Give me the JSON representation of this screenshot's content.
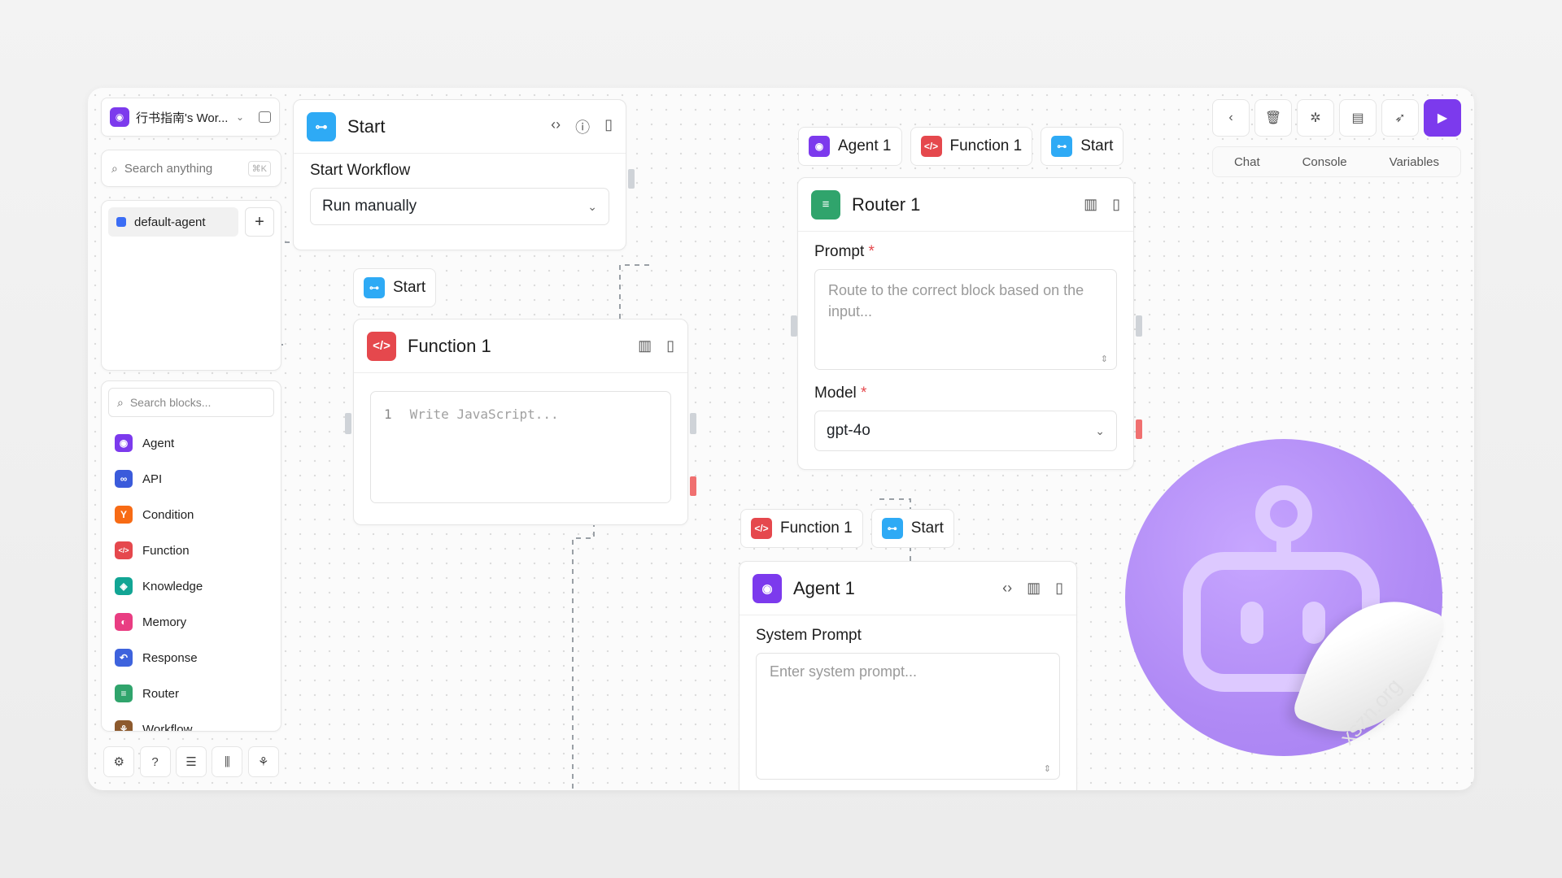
{
  "sidebar": {
    "workspace_title": "行书指南's Wor...",
    "search_placeholder": "Search anything",
    "search_shortcut": "⌘K",
    "agent_name": "default-agent",
    "block_search_placeholder": "Search blocks...",
    "blocks": [
      {
        "label": "Agent",
        "color": "#7c3aed",
        "icon": "robot-icon"
      },
      {
        "label": "API",
        "color": "#3b5bdb",
        "icon": "link-icon"
      },
      {
        "label": "Condition",
        "color": "#f76b15",
        "icon": "branch-icon"
      },
      {
        "label": "Function",
        "color": "#e5484d",
        "icon": "code-icon"
      },
      {
        "label": "Knowledge",
        "color": "#12a594",
        "icon": "knowledge-icon"
      },
      {
        "label": "Memory",
        "color": "#e93d82",
        "icon": "brain-icon"
      },
      {
        "label": "Response",
        "color": "#3e63dd",
        "icon": "reply-icon"
      },
      {
        "label": "Router",
        "color": "#30a46c",
        "icon": "router-icon"
      },
      {
        "label": "Workflow",
        "color": "#8d5a2e",
        "icon": "workflow-icon"
      }
    ],
    "bottom_icons": [
      "settings-icon",
      "help-icon",
      "logs-icon",
      "library-icon",
      "share-icon"
    ]
  },
  "start_node": {
    "title": "Start",
    "field_label": "Start Workflow",
    "select_value": "Run manually"
  },
  "function_node": {
    "connection_tag": "Start",
    "title": "Function 1",
    "line_number": "1",
    "code_placeholder": "Write JavaScript..."
  },
  "router_node": {
    "tags": [
      "Agent 1",
      "Function 1",
      "Start"
    ],
    "title": "Router 1",
    "prompt_label": "Prompt",
    "prompt_placeholder": "Route to the correct block based on the input...",
    "model_label": "Model",
    "model_value": "gpt-4o",
    "required_mark": "*"
  },
  "agent_node": {
    "tags": [
      "Function 1",
      "Start"
    ],
    "title": "Agent 1",
    "system_prompt_label": "System Prompt",
    "system_prompt_placeholder": "Enter system prompt..."
  },
  "toolbar": {
    "tabs": [
      "Chat",
      "Console",
      "Variables"
    ],
    "icons": [
      "back-icon",
      "trash-icon",
      "debug-icon",
      "bookmark-icon",
      "rocket-icon",
      "play-icon"
    ]
  },
  "colors": {
    "accent": "#7c3aed",
    "start": "#2eaaf5",
    "function": "#e5484d",
    "router": "#30a46c",
    "agent": "#7c3aed"
  },
  "watermark": "xszn.org"
}
